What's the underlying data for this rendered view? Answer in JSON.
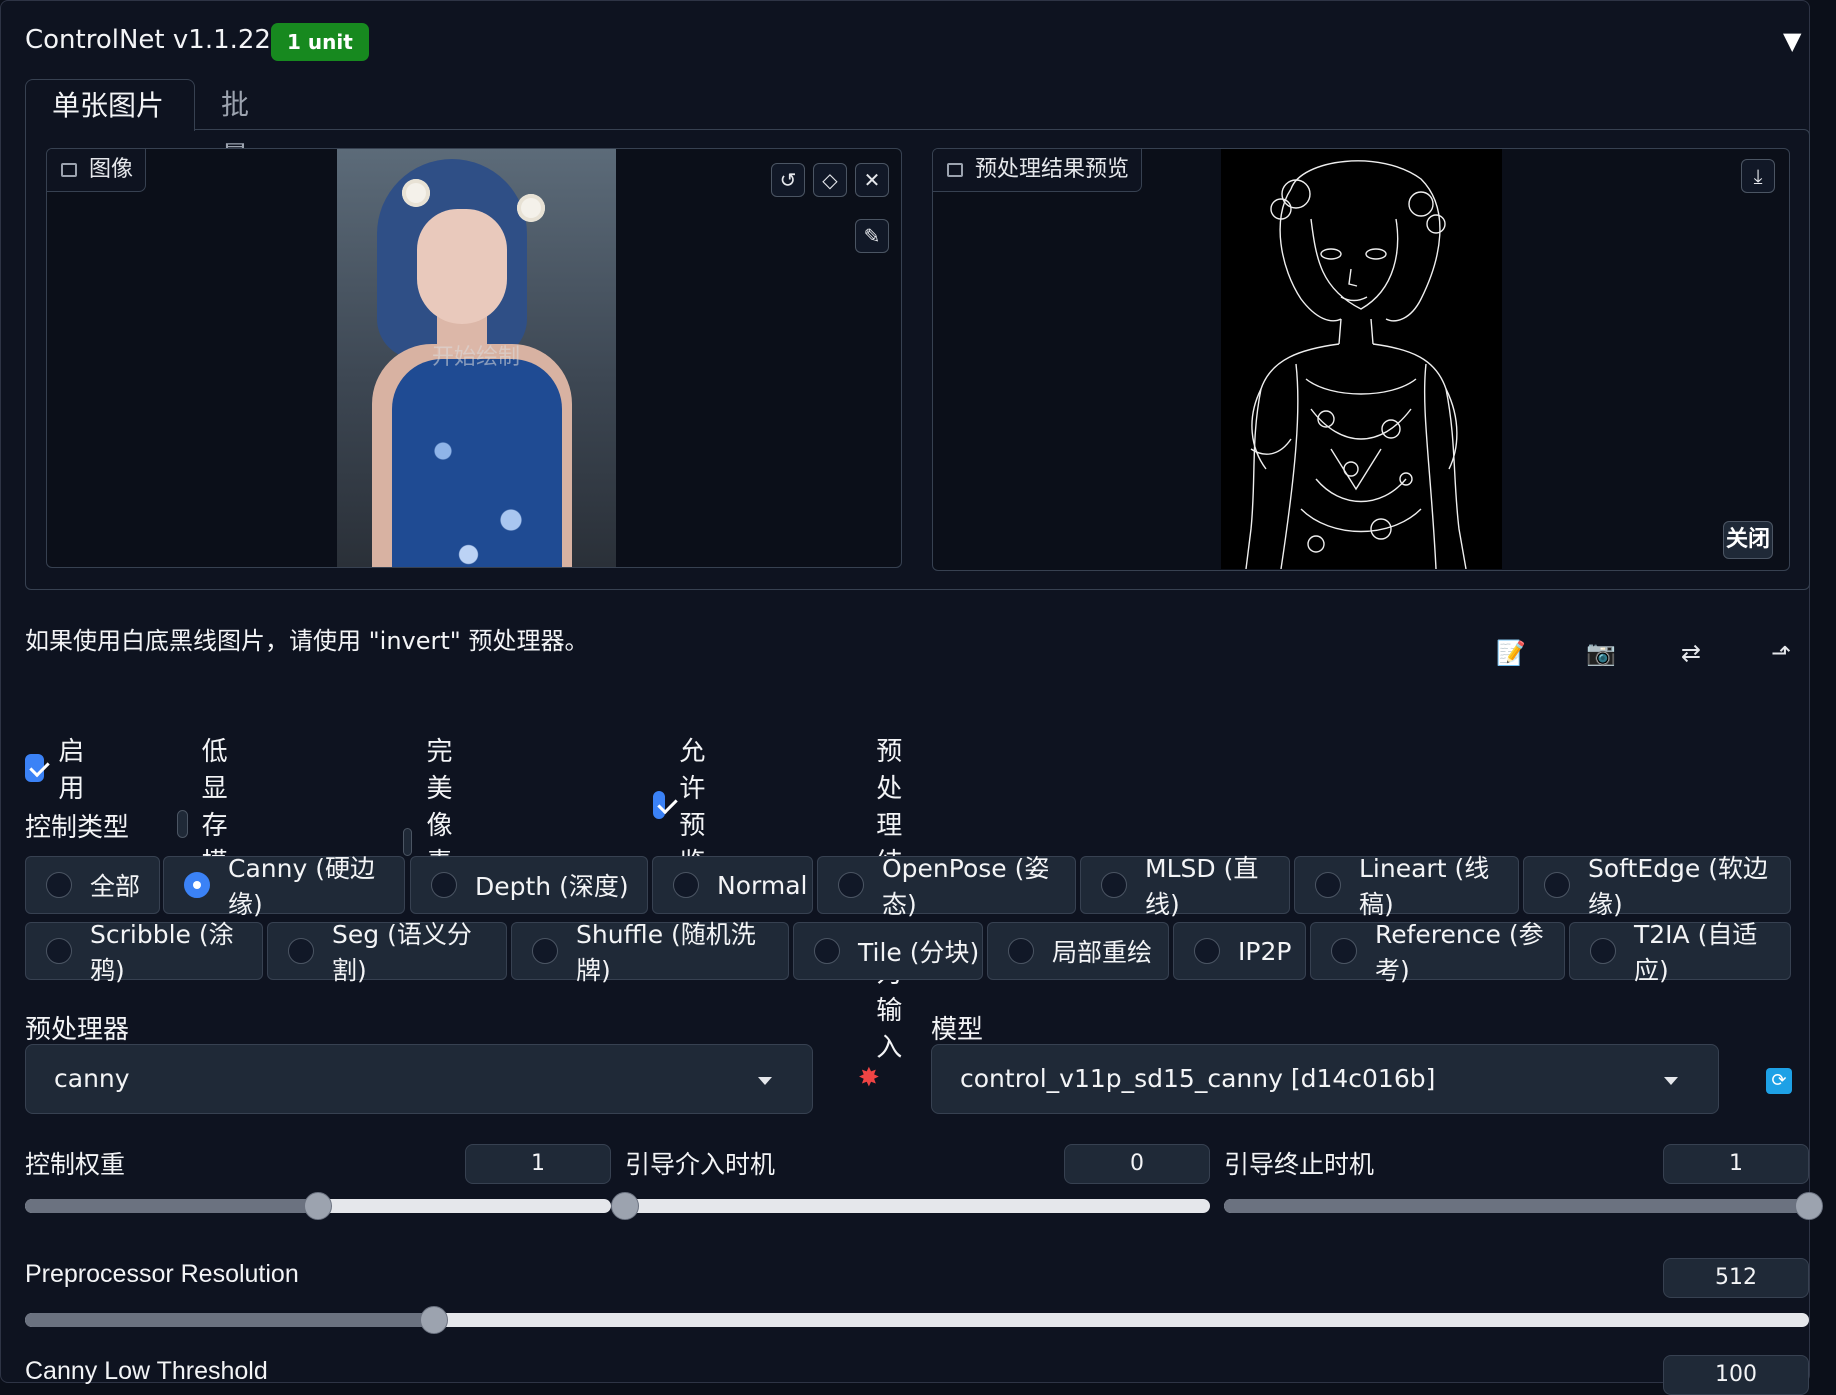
{
  "header": {
    "title": "ControlNet v1.1.224",
    "badge": "1 unit",
    "collapse_icon": "triangle-down-icon"
  },
  "tabs": [
    {
      "label": "单张图片",
      "active": true
    },
    {
      "label": "批量处理",
      "active": false
    }
  ],
  "input_image": {
    "label": "图像",
    "overlay_text": "开始绘制"
  },
  "preview_image": {
    "label": "预处理结果预览",
    "close_label": "关闭"
  },
  "hint_text": "如果使用白底黑线图片，请使用 \"invert\" 预处理器。",
  "toolbar_icons": [
    "memo-icon",
    "camera-icon",
    "swap-icon",
    "send-up-icon"
  ],
  "checkboxes": [
    {
      "label": "启用",
      "checked": true
    },
    {
      "label": "低显存模式",
      "checked": false
    },
    {
      "label": "完美像素模式",
      "checked": false
    },
    {
      "label": "允许预览",
      "checked": true
    },
    {
      "label": "预处理结果作为输入",
      "checked": false
    }
  ],
  "control_type": {
    "label": "控制类型",
    "options": [
      {
        "label": "全部",
        "selected": false
      },
      {
        "label": "Canny (硬边缘)",
        "selected": true
      },
      {
        "label": "Depth (深度)",
        "selected": false
      },
      {
        "label": "Normal",
        "selected": false
      },
      {
        "label": "OpenPose (姿态)",
        "selected": false
      },
      {
        "label": "MLSD (直线)",
        "selected": false
      },
      {
        "label": "Lineart (线稿)",
        "selected": false
      },
      {
        "label": "SoftEdge (软边缘)",
        "selected": false
      },
      {
        "label": "Scribble (涂鸦)",
        "selected": false
      },
      {
        "label": "Seg (语义分割)",
        "selected": false
      },
      {
        "label": "Shuffle (随机洗牌)",
        "selected": false
      },
      {
        "label": "Tile (分块)",
        "selected": false
      },
      {
        "label": "局部重绘",
        "selected": false
      },
      {
        "label": "IP2P",
        "selected": false
      },
      {
        "label": "Reference (参考)",
        "selected": false
      },
      {
        "label": "T2IA (自适应)",
        "selected": false
      }
    ]
  },
  "preprocessor": {
    "label": "预处理器",
    "value": "canny",
    "run_icon": "explosion-icon"
  },
  "model": {
    "label": "模型",
    "value": "control_v11p_sd15_canny [d14c016b]",
    "refresh_icon": "refresh-icon"
  },
  "sliders": {
    "weight": {
      "label": "控制权重",
      "value": "1",
      "fraction": 0.5
    },
    "start": {
      "label": "引导介入时机",
      "value": "0",
      "fraction": 0.0
    },
    "end": {
      "label": "引导终止时机",
      "value": "1",
      "fraction": 1.0
    },
    "resolution": {
      "label": "Preprocessor Resolution",
      "value": "512",
      "fraction": 0.229
    },
    "low_threshold": {
      "label": "Canny Low Threshold",
      "value": "100"
    }
  },
  "colors": {
    "accent": "#3b82f6",
    "badge": "#17891f",
    "background": "#0b0f19"
  }
}
